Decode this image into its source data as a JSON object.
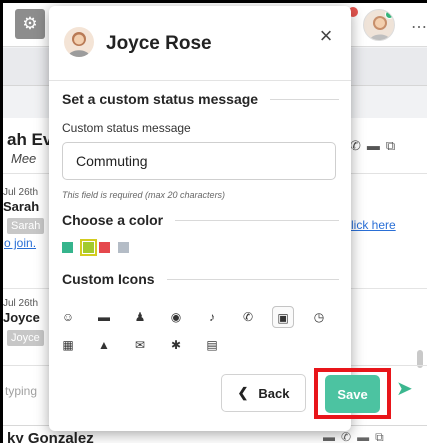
{
  "app": {
    "settings_icon": "gear-icon",
    "user_avatar_icon": "person-avatar-icon",
    "more_icon": "more-icon"
  },
  "chat": {
    "header_name": "ah Ev",
    "header_subtitle": "Mee",
    "messages": [
      {
        "date": "Jul 26th",
        "sender": "Sarah",
        "chip": "Sarah",
        "link_left": "o join.",
        "link_right": "lick here"
      },
      {
        "date": "Jul 26th",
        "sender": "Joyce",
        "chip": "Joyce"
      }
    ],
    "composer_placeholder": "typing",
    "bottom_contact": "ky Gonzalez"
  },
  "popup": {
    "title": "Joyce Rose",
    "close_label": "×",
    "status_section_title": "Set a custom status message",
    "status_field_label": "Custom status message",
    "status_value": "Commuting",
    "status_hint": "This field is required (max 20 characters)",
    "color_section_title": "Choose a color",
    "colors": [
      {
        "name": "green",
        "hex": "#35b48c",
        "selected": false
      },
      {
        "name": "yellow-green",
        "hex": "#a3cb2c",
        "selected": true
      },
      {
        "name": "red",
        "hex": "#e5484d",
        "selected": false
      },
      {
        "name": "gray",
        "hex": "#b4bcc6",
        "selected": false
      }
    ],
    "icons_section_title": "Custom Icons",
    "icons": [
      {
        "name": "smile-icon",
        "glyph": "☺",
        "selected": false
      },
      {
        "name": "folder-icon",
        "glyph": "▬",
        "selected": false
      },
      {
        "name": "person-icon",
        "glyph": "♟",
        "selected": false
      },
      {
        "name": "user-circle-icon",
        "glyph": "◉",
        "selected": false
      },
      {
        "name": "bell-icon",
        "glyph": "♪",
        "selected": false
      },
      {
        "name": "phone-icon",
        "glyph": "✆",
        "selected": false
      },
      {
        "name": "briefcase-icon",
        "glyph": "▣",
        "selected": true
      },
      {
        "name": "history-icon",
        "glyph": "◷",
        "selected": false
      },
      {
        "name": "bus-icon",
        "glyph": "▦",
        "selected": false
      },
      {
        "name": "home-icon",
        "glyph": "▲",
        "selected": false
      },
      {
        "name": "mail-icon",
        "glyph": "✉",
        "selected": false
      },
      {
        "name": "bug-icon",
        "glyph": "✱",
        "selected": false
      },
      {
        "name": "calendar-icon",
        "glyph": "▤",
        "selected": false
      }
    ],
    "back_label": "Back",
    "save_label": "Save"
  },
  "colors": {
    "accent": "#4cc3a1",
    "highlight": "#e8151a"
  }
}
